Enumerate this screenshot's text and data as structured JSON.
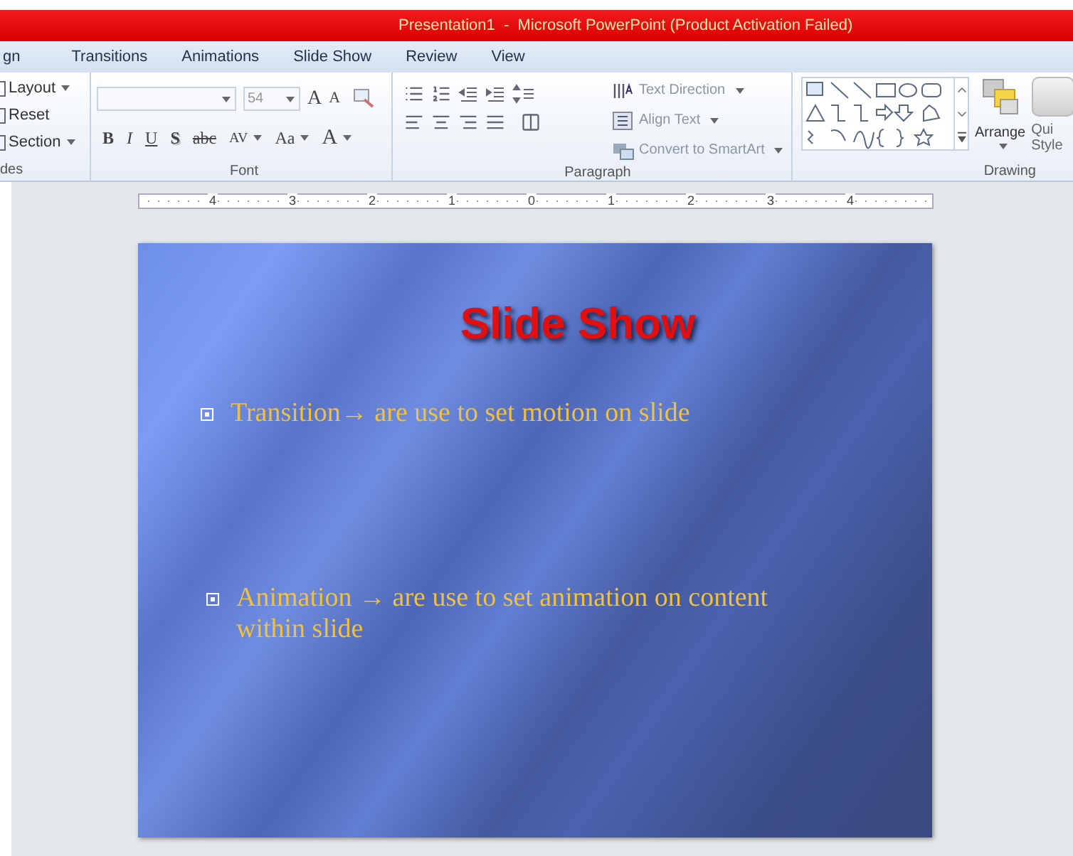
{
  "window": {
    "title": "Presentation1  -  Microsoft PowerPoint (Product Activation Failed)"
  },
  "tabs": [
    {
      "label": "gn",
      "selected": false
    },
    {
      "label": "Transitions",
      "selected": false
    },
    {
      "label": "Animations",
      "selected": false
    },
    {
      "label": "Slide Show",
      "selected": false
    },
    {
      "label": "Review",
      "selected": false
    },
    {
      "label": "View",
      "selected": false
    }
  ],
  "ribbon": {
    "slides_group": {
      "buttons": [
        {
          "label": "Layout",
          "dropdown": true
        },
        {
          "label": "Reset",
          "dropdown": false
        },
        {
          "label": "Section",
          "dropdown": true
        }
      ],
      "label": "des"
    },
    "font_group": {
      "font_size": "54",
      "grow_shrink": [
        "A",
        "A"
      ],
      "format_buttons": [
        {
          "label": "B",
          "kind": "bold",
          "dropdown": false
        },
        {
          "label": "I",
          "kind": "italic",
          "dropdown": false
        },
        {
          "label": "U",
          "kind": "underline",
          "dropdown": false
        },
        {
          "label": "S",
          "kind": "shadow",
          "dropdown": false
        },
        {
          "label": "abc",
          "kind": "strike",
          "dropdown": false
        },
        {
          "label": "AV",
          "kind": "spacing",
          "dropdown": true
        },
        {
          "label": "Aa",
          "kind": "case",
          "dropdown": true
        },
        {
          "label": "A",
          "kind": "color",
          "dropdown": true
        }
      ],
      "label": "Font"
    },
    "paragraph_group": {
      "commands": [
        {
          "label": "Text Direction",
          "kind": "direction",
          "disabled": true
        },
        {
          "label": "Align Text",
          "kind": "align",
          "disabled": true
        },
        {
          "label": "Convert to SmartArt",
          "kind": "smartart",
          "disabled": true
        }
      ],
      "label": "Paragraph"
    },
    "drawing_group": {
      "arrange": "Arrange",
      "quick_styles": [
        "Qui",
        "Style"
      ],
      "label": "Drawing"
    }
  },
  "ruler": [
    "4",
    "3",
    "2",
    "1",
    "0",
    "1",
    "2",
    "3",
    "4"
  ],
  "slide": {
    "title": "Slide Show",
    "bullets": [
      "Transition→ are use to set motion on slide",
      "Animation → are use to set animation on content within slide"
    ]
  }
}
